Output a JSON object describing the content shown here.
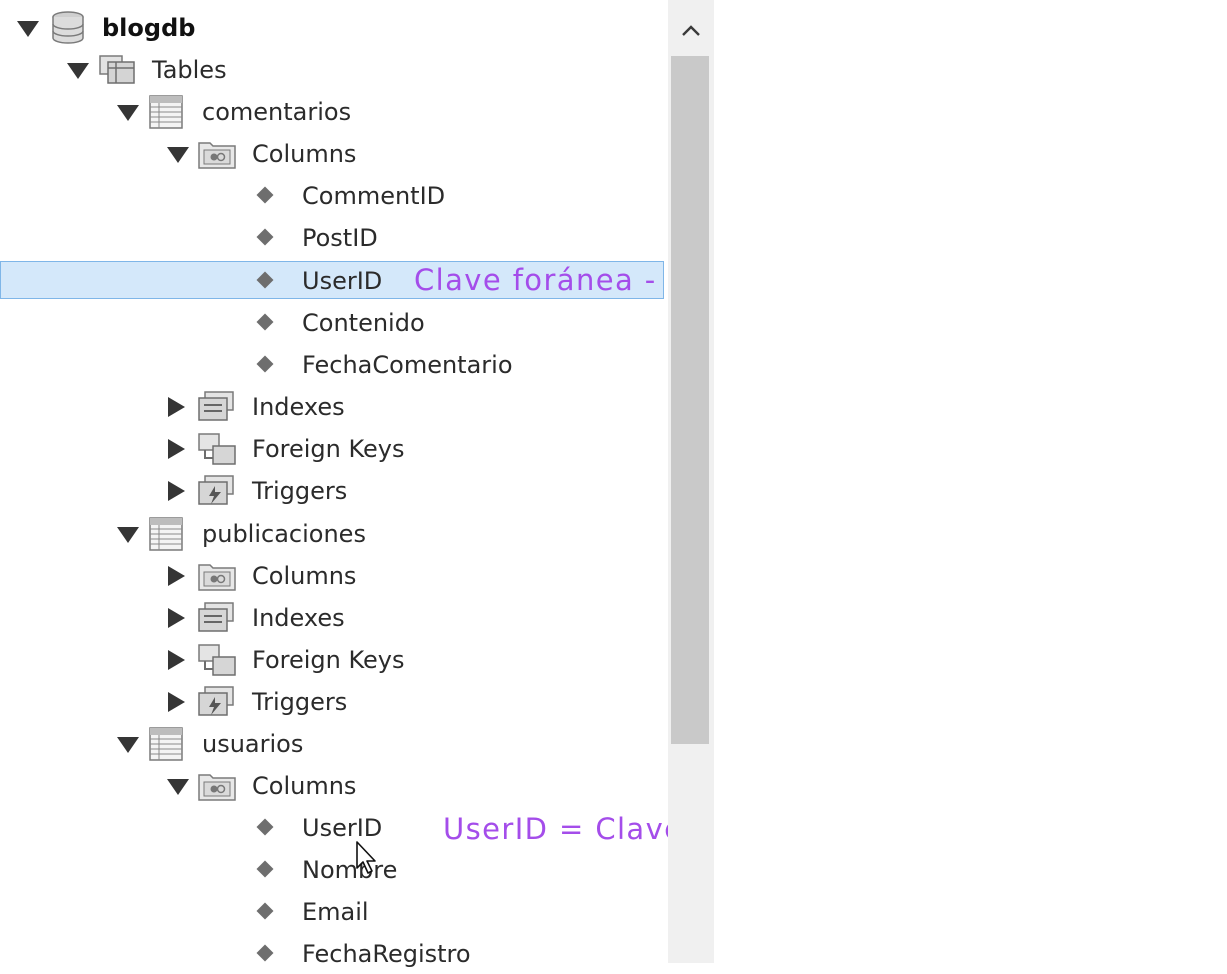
{
  "tree": {
    "database": "blogdb",
    "tables_folder": "Tables",
    "comentarios": {
      "name": "comentarios",
      "columns_folder": "Columns",
      "columns": [
        "CommentID",
        "PostID",
        "UserID",
        "Contenido",
        "FechaComentario"
      ],
      "indexes": "Indexes",
      "foreign_keys": "Foreign Keys",
      "triggers": "Triggers"
    },
    "publicaciones": {
      "name": "publicaciones",
      "columns_folder": "Columns",
      "indexes": "Indexes",
      "foreign_keys": "Foreign Keys",
      "triggers": "Triggers"
    },
    "usuarios": {
      "name": "usuarios",
      "columns_folder": "Columns",
      "columns": [
        "UserID",
        "Nombre",
        "Email",
        "FechaRegistro"
      ]
    }
  },
  "annotations": {
    "foreign_key": "Clave foránea - UserID",
    "primary_key": "UserID = Clave primaria = PK (Primary Key)"
  },
  "scrollbar": {
    "up_arrow": "^"
  },
  "colors": {
    "annotation": "#a44dea",
    "selection_bg": "#d4e8fa",
    "selection_border": "#7fb6e8"
  },
  "icons": {
    "database": "database-icon",
    "folder": "tables-folder-icon",
    "table": "table-icon",
    "columns": "columns-folder-icon",
    "column": "column-icon",
    "indexes": "indexes-folder-icon",
    "foreign_keys": "foreign-keys-folder-icon",
    "triggers": "triggers-folder-icon"
  }
}
